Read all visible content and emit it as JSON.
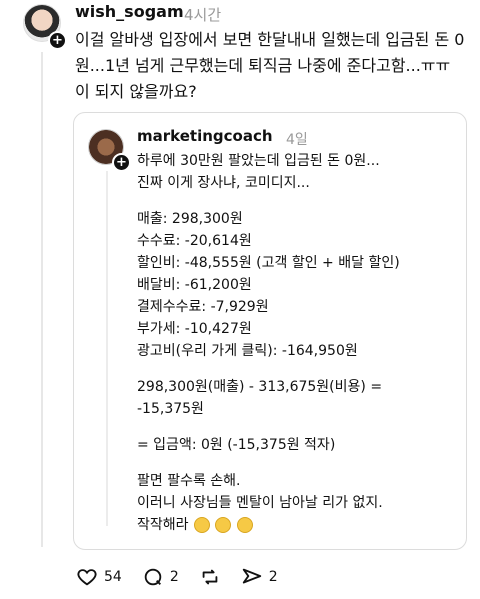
{
  "post": {
    "username": "wish_sogam",
    "time": "4시간",
    "text": "이걸 알바생 입장에서 보면 한달내내 일했는데 입금된 돈 0원...1년 넘게 근무했는데 퇴직금 나중에 준다고함...ㅠㅠ 이 되지 않을까요?"
  },
  "quoted": {
    "username": "marketingcoach",
    "time": "4일",
    "lines": [
      "하루에 30만원 팔았는데 입금된 돈 0원...",
      "진짜 이게 장사냐, 코미디지...",
      "",
      "매출: 298,300원",
      "수수료: -20,614원",
      "할인비: -48,555원 (고객 할인 + 배달 할인)",
      "배달비: -61,200원",
      "결제수수료: -7,929원",
      "부가세: -10,427원",
      "광고비(우리 가게 클릭): -164,950원",
      "",
      "298,300원(매출) - 313,675원(비용) =",
      "-15,375원",
      "",
      "= 입금액: 0원 (-15,375원 적자)",
      "",
      "팔면 팔수록 손해.",
      "이러니 사장님들 멘탈이 남아날 리가 없지.",
      "작작해라"
    ]
  },
  "actions": {
    "likes": "54",
    "comments": "2",
    "reposts": "",
    "shares": "2"
  },
  "icons": {
    "like": "heart-icon",
    "comment": "comment-icon",
    "repost": "repost-icon",
    "share": "share-icon"
  }
}
